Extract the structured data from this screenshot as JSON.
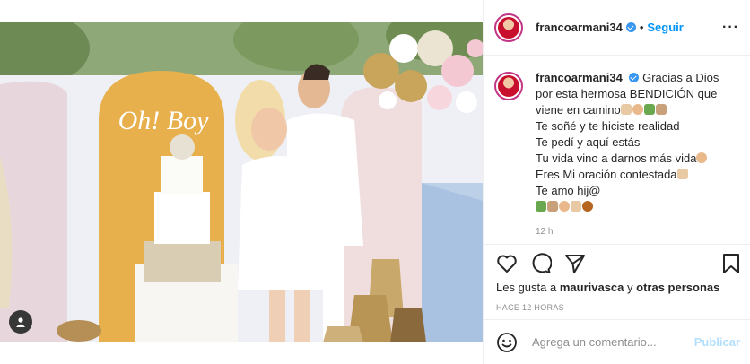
{
  "post": {
    "username": "francoarmani34",
    "separator": "•",
    "follow_label": "Seguir",
    "more_label": "···"
  },
  "caption": {
    "username": "francoarmani34",
    "lines": [
      "Gracias a Dios por esta hermosa BENDICIÓN que viene en camino",
      "Te soñé y te hiciste realidad",
      "Te pedí y aquí estás",
      "Tu vida vino a darnos más vida",
      "Eres Mi oración contestada",
      "Te amo hij@"
    ],
    "time": "12 h"
  },
  "photo": {
    "sign_text": "Oh! Boy"
  },
  "likes": {
    "prefix": "Les gusta a",
    "user": "maurivasca",
    "connector": "y",
    "others": "otras personas"
  },
  "timestamp": "HACE 12 HORAS",
  "comment_box": {
    "placeholder": "Agrega un comentario...",
    "publish_label": "Publicar"
  },
  "colors": {
    "accent": "#0095f6",
    "verified": "#3897f0",
    "publish_disabled": "#b2dffc",
    "muted": "#8e8e8e"
  }
}
